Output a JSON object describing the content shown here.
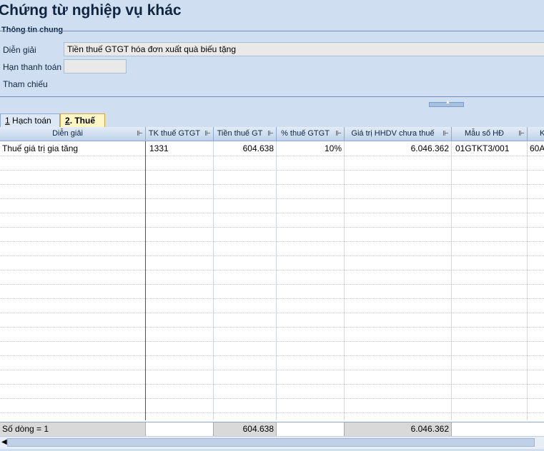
{
  "page": {
    "title": "Chứng từ nghiệp vụ khác",
    "section_title": "Thông tin chung"
  },
  "form": {
    "dien_giai_label": "Diễn giải",
    "dien_giai_value": "Tiền thuế GTGT hóa đơn xuất quà biếu tặng",
    "han_thanh_toan_label": "Hạn thanh toán",
    "han_thanh_toan_value": "",
    "tham_chieu_label": "Tham chiếu"
  },
  "tabs": [
    {
      "key": "1",
      "label": " Hạch toán",
      "active": false
    },
    {
      "key": "2",
      "label": ". Thuế",
      "active": true
    }
  ],
  "grid": {
    "columns": [
      "Diễn giải",
      "TK thuế GTGT",
      "Tiền thuế GT",
      "% thuế GTGT",
      "Giá trị HHDV chưa thuế",
      "Mẫu số HĐ",
      "K"
    ],
    "rows": [
      [
        "Thuế giá trị gia tăng",
        "1331",
        "604.638",
        "10%",
        "6.046.362",
        "01GTKT3/001",
        "60A"
      ]
    ],
    "footer": {
      "row_count": "Số dòng = 1",
      "tien_thue_total": "604.638",
      "gia_tri_total": "6.046.362"
    }
  },
  "icons": {
    "pin": "pin-icon",
    "collapse": "chevron-up-icon",
    "scroll_left": "arrow-left-icon"
  }
}
